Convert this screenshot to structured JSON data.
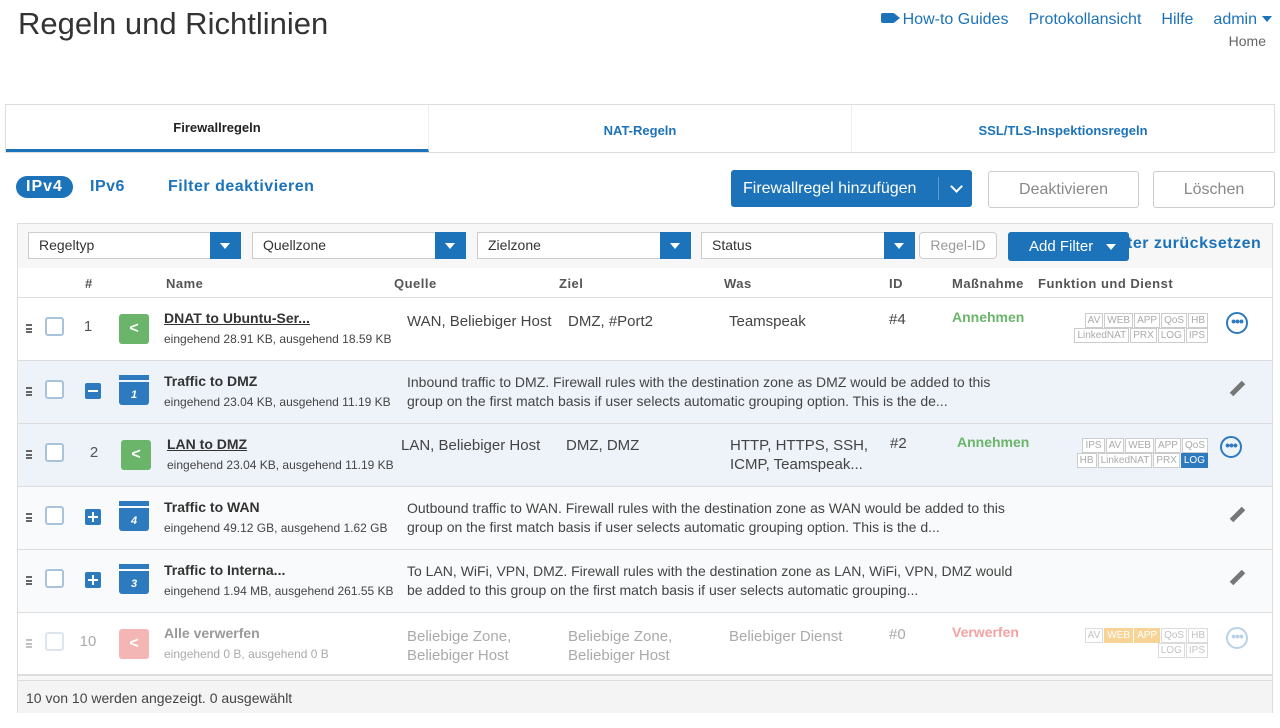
{
  "page": {
    "title": "Regeln und Richtlinien"
  },
  "topnav": {
    "guides": "How-to Guides",
    "log": "Protokollansicht",
    "help": "Hilfe",
    "user": "admin",
    "home": "Home"
  },
  "tabs": [
    "Firewallregeln",
    "NAT-Regeln",
    "SSL/TLS-Inspektionsregeln"
  ],
  "toolbar": {
    "ipv4": "IPv4",
    "ipv6": "IPv6",
    "filter_off": "Filter deaktivieren",
    "add": "Firewallregel hinzufügen",
    "deactivate": "Deaktivieren",
    "delete": "Löschen"
  },
  "filters": {
    "ruletype": "Regeltyp",
    "source": "Quellzone",
    "dest": "Zielzone",
    "status": "Status",
    "ruleid_placeholder": "Regel-ID",
    "add_filter": "Add Filter",
    "reset": "ter zurücksetzen"
  },
  "columns": {
    "num": "#",
    "name": "Name",
    "source": "Quelle",
    "dest": "Ziel",
    "what": "Was",
    "id": "ID",
    "action": "Maßnahme",
    "func": "Funktion und Dienst"
  },
  "rows": [
    {
      "num": "1",
      "name": "DNAT to Ubuntu-Ser...",
      "traffic": "eingehend 28.91 KB, ausgehend 18.59 KB",
      "source": "WAN, Beliebiger Host",
      "dest": "DMZ, #Port2",
      "what": "Teamspeak",
      "id": "#4",
      "action": "Annehmen"
    },
    {
      "group": "1",
      "name": "Traffic to DMZ",
      "traffic": "eingehend 23.04 KB, ausgehend 11.19 KB",
      "desc": "Inbound traffic to DMZ. Firewall rules with the destination zone as DMZ would be added to this group on the first match basis if user selects automatic grouping option. This is the de..."
    },
    {
      "num": "2",
      "name": "LAN to DMZ",
      "traffic": "eingehend 23.04 KB, ausgehend 11.19 KB",
      "source": "LAN, Beliebiger Host",
      "dest": "DMZ, DMZ",
      "what": "HTTP, HTTPS, SSH, ICMP, Teamspeak...",
      "id": "#2",
      "action": "Annehmen"
    },
    {
      "group": "4",
      "name": "Traffic to WAN",
      "traffic": "eingehend 49.12 GB, ausgehend 1.62 GB",
      "desc": "Outbound traffic to WAN. Firewall rules with the destination zone as WAN would be added to this group on the first match basis if user selects automatic grouping option. This is the d..."
    },
    {
      "group": "3",
      "name": "Traffic to Interna...",
      "traffic": "eingehend 1.94 MB, ausgehend 261.55 KB",
      "desc": "To LAN, WiFi, VPN, DMZ. Firewall rules with the destination zone as LAN, WiFi, VPN, DMZ would be added to this group on the first match basis if user selects automatic grouping..."
    },
    {
      "num": "10",
      "name": "Alle verwerfen",
      "traffic": "eingehend 0 B, ausgehend 0 B",
      "source": "Beliebige Zone, Beliebiger Host",
      "dest": "Beliebige Zone, Beliebiger Host",
      "what": "Beliebiger Dienst",
      "id": "#0",
      "action": "Verwerfen"
    }
  ],
  "badges": {
    "row1": [
      "AV",
      "WEB",
      "APP",
      "QoS",
      "HB",
      "LinkedNAT",
      "PRX",
      "LOG",
      "IPS"
    ],
    "row2": [
      "IPS",
      "AV",
      "WEB",
      "APP",
      "QoS",
      "HB",
      "LinkedNAT",
      "PRX",
      "LOG"
    ],
    "row3": [
      "AV",
      "WEB",
      "APP",
      "QoS",
      "HB",
      "LOG",
      "IPS"
    ]
  },
  "footer": {
    "status": "10 von 10 werden angezeigt. 0 ausgewählt"
  },
  "colors": {
    "primary": "#1c73b9",
    "accept": "#6ab56a",
    "drop": "#f4a2a2"
  }
}
